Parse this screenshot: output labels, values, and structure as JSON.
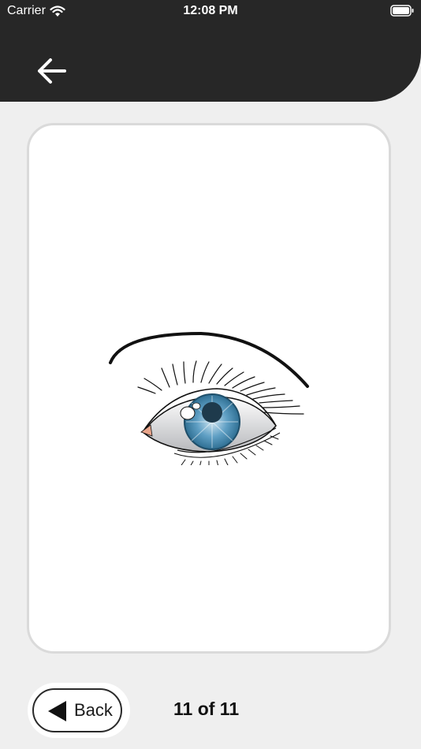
{
  "status_bar": {
    "carrier": "Carrier",
    "time": "12:08 PM"
  },
  "header": {
    "back_icon": "arrow-left-icon"
  },
  "card": {
    "image": "eye-illustration"
  },
  "footer": {
    "back_label": "Back",
    "page_counter": "11 of 11"
  },
  "colors": {
    "header_bg": "#272727",
    "page_bg": "#efefef",
    "card_bg": "#ffffff",
    "iris": "#4a8fb5"
  }
}
